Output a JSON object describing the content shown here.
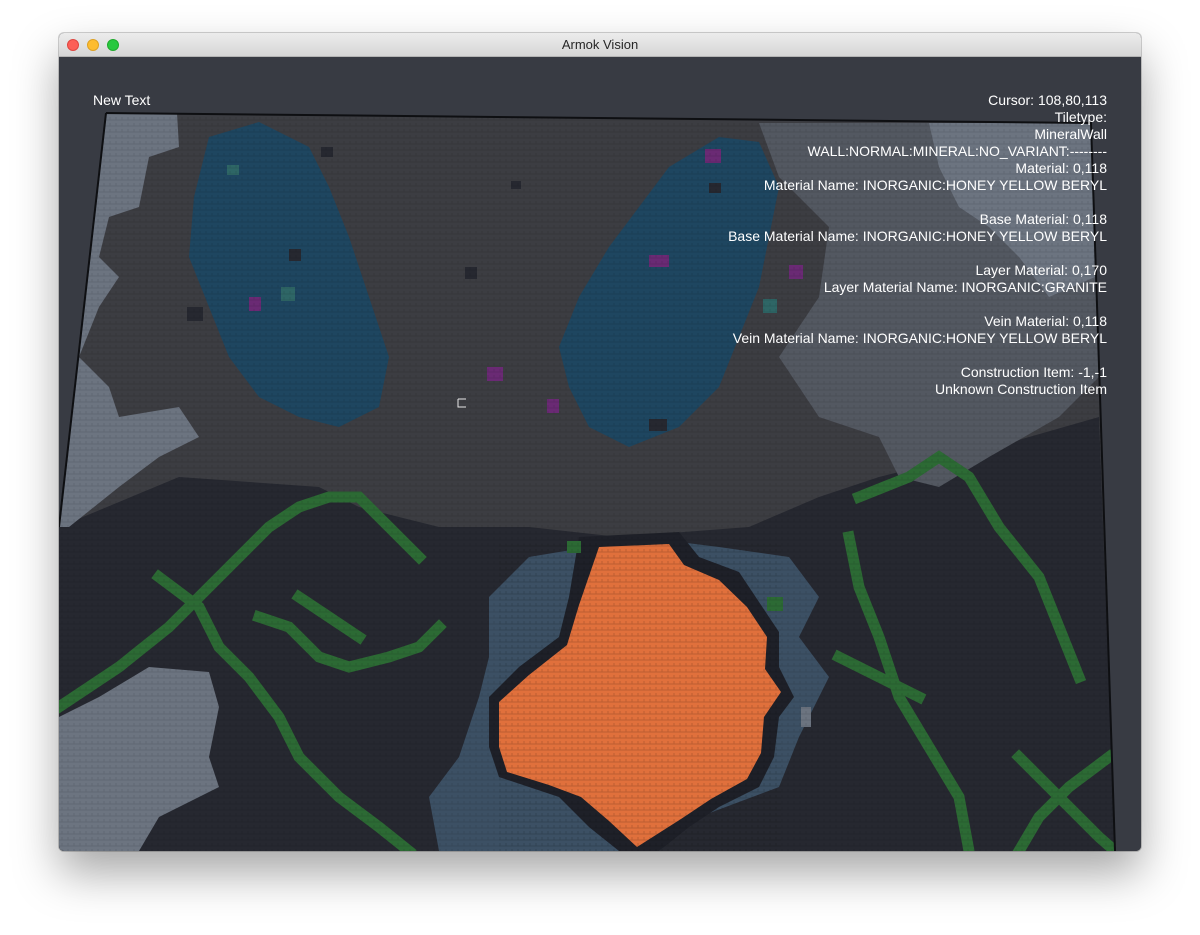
{
  "window": {
    "title": "Armok Vision"
  },
  "hud": {
    "placeholder_text": "New Text",
    "cursor": "Cursor: 108,80,113",
    "tiletype_label": "Tiletype:",
    "tiletype_name": "MineralWall",
    "tiletype_detail": "WALL:NORMAL:MINERAL:NO_VARIANT:--------",
    "material": "Material: 0,118",
    "material_name": "Material Name: INORGANIC:HONEY YELLOW BERYL",
    "base_material": "Base Material: 0,118",
    "base_material_name": "Base Material Name: INORGANIC:HONEY YELLOW BERYL",
    "layer_material": "Layer Material: 0,170",
    "layer_material_name": "Layer Material Name: INORGANIC:GRANITE",
    "vein_material": "Vein Material: 0,118",
    "vein_material_name": "Vein Material Name: INORGANIC:HONEY YELLOW BERYL",
    "construction_item": "Construction Item: -1,-1",
    "construction_item_name": "Unknown Construction Item"
  },
  "colors": {
    "background": "#383b43",
    "granite": "#3c3d42",
    "dark_stone": "#262830",
    "light_stone": "#6c7480",
    "mid_stone": "#535861",
    "ore_blue": "#1e4660",
    "vein_green": "#2c6a34",
    "magma_orange": "#e0703c",
    "slate_blue": "#3c5064",
    "gem_purple": "#6a2a74",
    "gem_teal": "#2e6666"
  }
}
